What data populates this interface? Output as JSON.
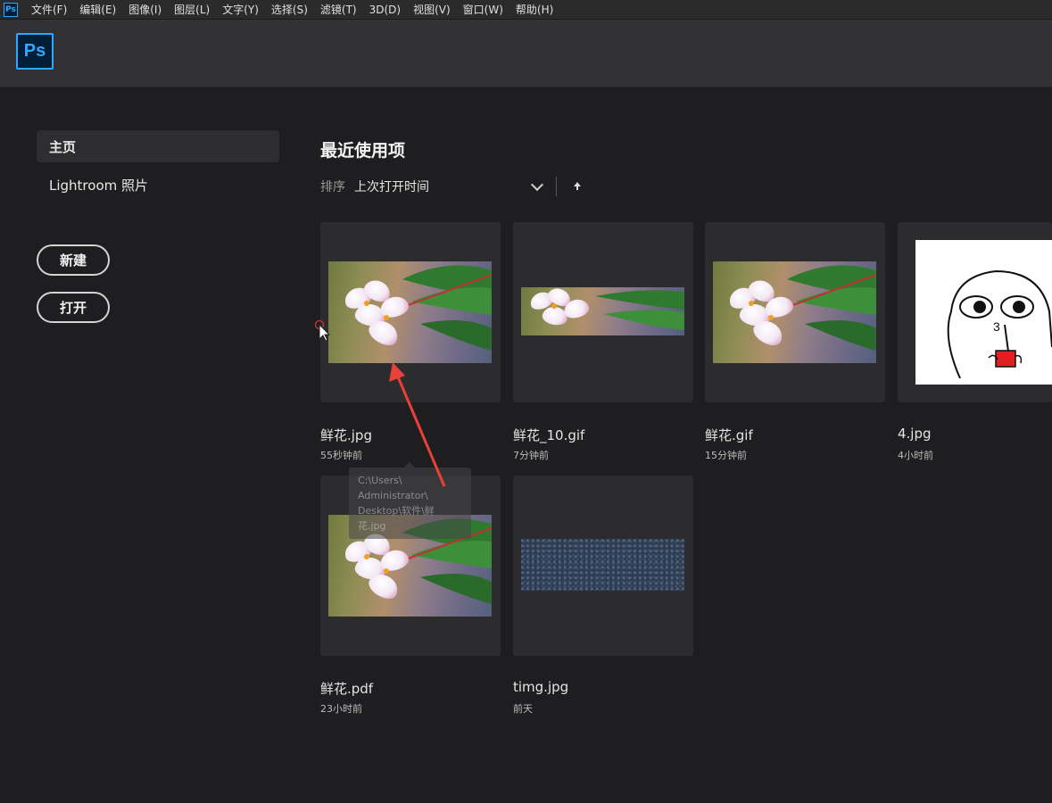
{
  "app": {
    "icon_text": "Ps",
    "logo_text": "Ps",
    "brand_color": "#31a8ff"
  },
  "menubar": {
    "items": [
      "文件(F)",
      "编辑(E)",
      "图像(I)",
      "图层(L)",
      "文字(Y)",
      "选择(S)",
      "滤镜(T)",
      "3D(D)",
      "视图(V)",
      "窗口(W)",
      "帮助(H)"
    ]
  },
  "sidebar": {
    "items": [
      {
        "label": "主页",
        "active": true
      },
      {
        "label": "Lightroom 照片",
        "active": false
      }
    ],
    "new_button": "新建",
    "open_button": "打开"
  },
  "main": {
    "title": "最近使用项",
    "sort": {
      "label": "排序",
      "value": "上次打开时间"
    },
    "files": [
      {
        "name": "鲜花.jpg",
        "time": "55秒钟前",
        "thumb": "flower-wide"
      },
      {
        "name": "鲜花_10.gif",
        "time": "7分钟前",
        "thumb": "flower-strip"
      },
      {
        "name": "鲜花.gif",
        "time": "15分钟前",
        "thumb": "flower-wide"
      },
      {
        "name": "4.jpg",
        "time": "4小时前",
        "thumb": "cartoon"
      },
      {
        "name": "鲜花.pdf",
        "time": "23小时前",
        "thumb": "flower-wide"
      },
      {
        "name": "timg.jpg",
        "time": "前天",
        "thumb": "texture"
      }
    ],
    "tooltip": {
      "lines": [
        "C:\\Users\\",
        "Administrator\\",
        "Desktop\\软件\\鲜",
        "花.jpg"
      ]
    }
  },
  "colors": {
    "background": "#1e1e20",
    "header": "#323234",
    "card": "#2c2c2e",
    "annotation_arrow": "#e8413a"
  }
}
